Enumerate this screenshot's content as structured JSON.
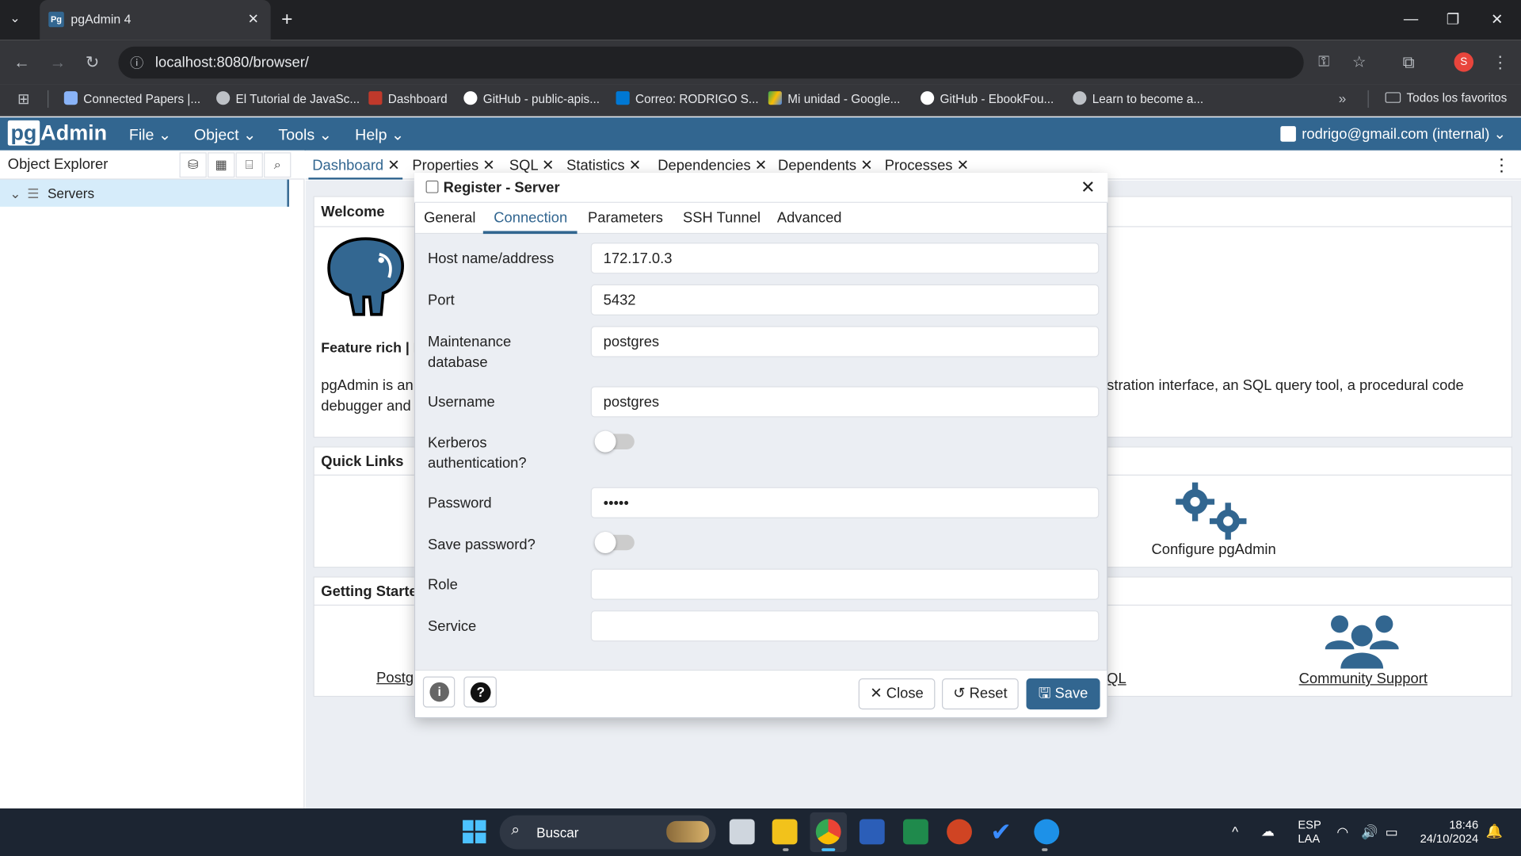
{
  "browser": {
    "tab_title": "pgAdmin 4",
    "url": "localhost:8080/browser/",
    "bookmarks": [
      "Connected Papers |...",
      "El Tutorial de JavaSc...",
      "Dashboard",
      "GitHub - public-apis...",
      "Correo: RODRIGO S...",
      "Mi unidad - Google...",
      "GitHub - EbookFou...",
      "Learn to become a..."
    ],
    "all_bookmarks": "Todos los favoritos",
    "profile_initial": "S"
  },
  "app": {
    "logo_pg": "pg",
    "logo_rest": "Admin",
    "menus": [
      "File",
      "Object",
      "Tools",
      "Help"
    ],
    "user": "rodrigo@gmail.com (internal)"
  },
  "explorer": {
    "title": "Object Explorer",
    "servers": "Servers"
  },
  "main_tabs": [
    "Dashboard",
    "Properties",
    "SQL",
    "Statistics",
    "Dependencies",
    "Dependents",
    "Processes"
  ],
  "dashboard": {
    "welcome": "Welcome",
    "feature": "Feature rich | M",
    "desc_left1": "pgAdmin is an",
    "desc_left2": "debugger and m",
    "desc_right": "stration interface, an SQL query tool, a procedural code",
    "quick_links": "Quick Links",
    "configure": "Configure pgAdmin",
    "getting_started": "Getting Started",
    "postgres_link": "Postg",
    "sql_link": "QL",
    "community": "Community Support"
  },
  "dialog": {
    "title": "Register - Server",
    "tabs": [
      "General",
      "Connection",
      "Parameters",
      "SSH Tunnel",
      "Advanced"
    ],
    "labels": {
      "host": "Host name/address",
      "port": "Port",
      "maint1": "Maintenance",
      "maint2": "database",
      "username": "Username",
      "kerberos1": "Kerberos",
      "kerberos2": "authentication?",
      "password": "Password",
      "save_password": "Save password?",
      "role": "Role",
      "service": "Service"
    },
    "values": {
      "host": "172.17.0.3",
      "port": "5432",
      "maintenance_db": "postgres",
      "username": "postgres",
      "kerberos": false,
      "password": "•••••",
      "save_password": false,
      "role": "",
      "service": ""
    },
    "buttons": {
      "close": "Close",
      "reset": "Reset",
      "save": "Save"
    }
  },
  "taskbar": {
    "search": "Buscar",
    "lang1": "ESP",
    "lang2": "LAA",
    "time": "18:46",
    "date": "24/10/2024"
  }
}
